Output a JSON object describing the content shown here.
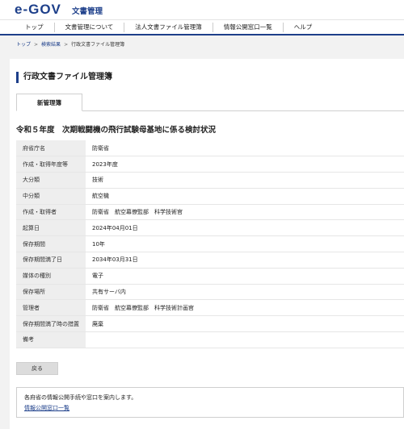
{
  "header": {
    "logo": "e-GOV",
    "logo_sub": "文書管理"
  },
  "nav": [
    "トップ",
    "文書管理について",
    "法人文書ファイル管理簿",
    "情報公開窓口一覧",
    "ヘルプ"
  ],
  "breadcrumb": {
    "home": "トップ",
    "sep1": ">",
    "results": "検索結果",
    "sep2": ">",
    "current": "行政文書ファイル管理簿"
  },
  "page_title": "行政文書ファイル管理簿",
  "tab_label": "新管理簿",
  "doc_title": "令和５年度　次期戦闘機の飛行試験母基地に係る検討状況",
  "rows": [
    {
      "key": "府省庁名",
      "value": "防衛省"
    },
    {
      "key": "作成・取得年度等",
      "value": "2023年度"
    },
    {
      "key": "大分類",
      "value": "技術"
    },
    {
      "key": "中分類",
      "value": "航空機"
    },
    {
      "key": "作成・取得者",
      "value": "防衛省　航空幕僚監部　科学技術官"
    },
    {
      "key": "起算日",
      "value": "2024年04月01日"
    },
    {
      "key": "保存期間",
      "value": "10年"
    },
    {
      "key": "保存期間満了日",
      "value": "2034年03月31日"
    },
    {
      "key": "媒体の種別",
      "value": "電子"
    },
    {
      "key": "保存場所",
      "value": "共有サーバ内"
    },
    {
      "key": "管理者",
      "value": "防衛省　航空幕僚監部　科学技術計画官"
    },
    {
      "key": "保存期間満了時の措置",
      "value": "廃棄"
    },
    {
      "key": "備考",
      "value": ""
    }
  ],
  "back_label": "戻る",
  "info": {
    "text": "各府省の情報公開手続や窓口を案内します。",
    "link": "情報公開窓口一覧"
  }
}
